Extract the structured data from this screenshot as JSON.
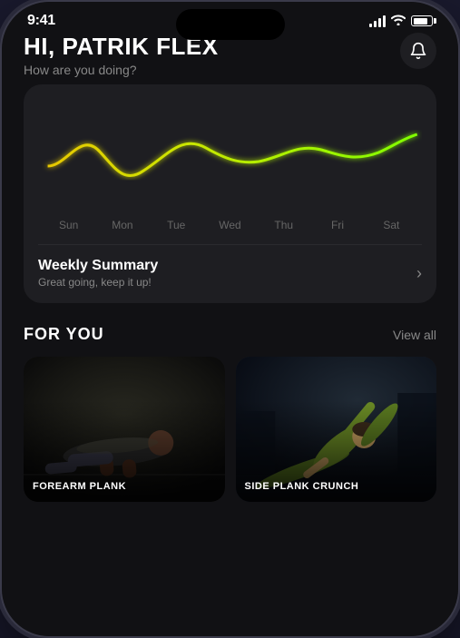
{
  "statusBar": {
    "time": "9:41"
  },
  "header": {
    "greeting": "HI, PATRIK FLEX",
    "subtitle": "How are you doing?"
  },
  "chart": {
    "days": [
      "Sun",
      "Mon",
      "Tue",
      "Wed",
      "Thu",
      "Fri",
      "Sat"
    ],
    "weeklySummary": {
      "title": "Weekly Summary",
      "subtitle": "Great going, keep it up!"
    }
  },
  "forYou": {
    "sectionTitle": "FOR YOU",
    "viewAll": "View all",
    "cards": [
      {
        "id": "forearm-plank",
        "label": "FOREARM PLANK"
      },
      {
        "id": "side-plank-crunch",
        "label": "SIDE PLANK CRUNCH"
      }
    ]
  },
  "colors": {
    "accent": "#b5e800",
    "accentGlow": "#c8ff00"
  }
}
